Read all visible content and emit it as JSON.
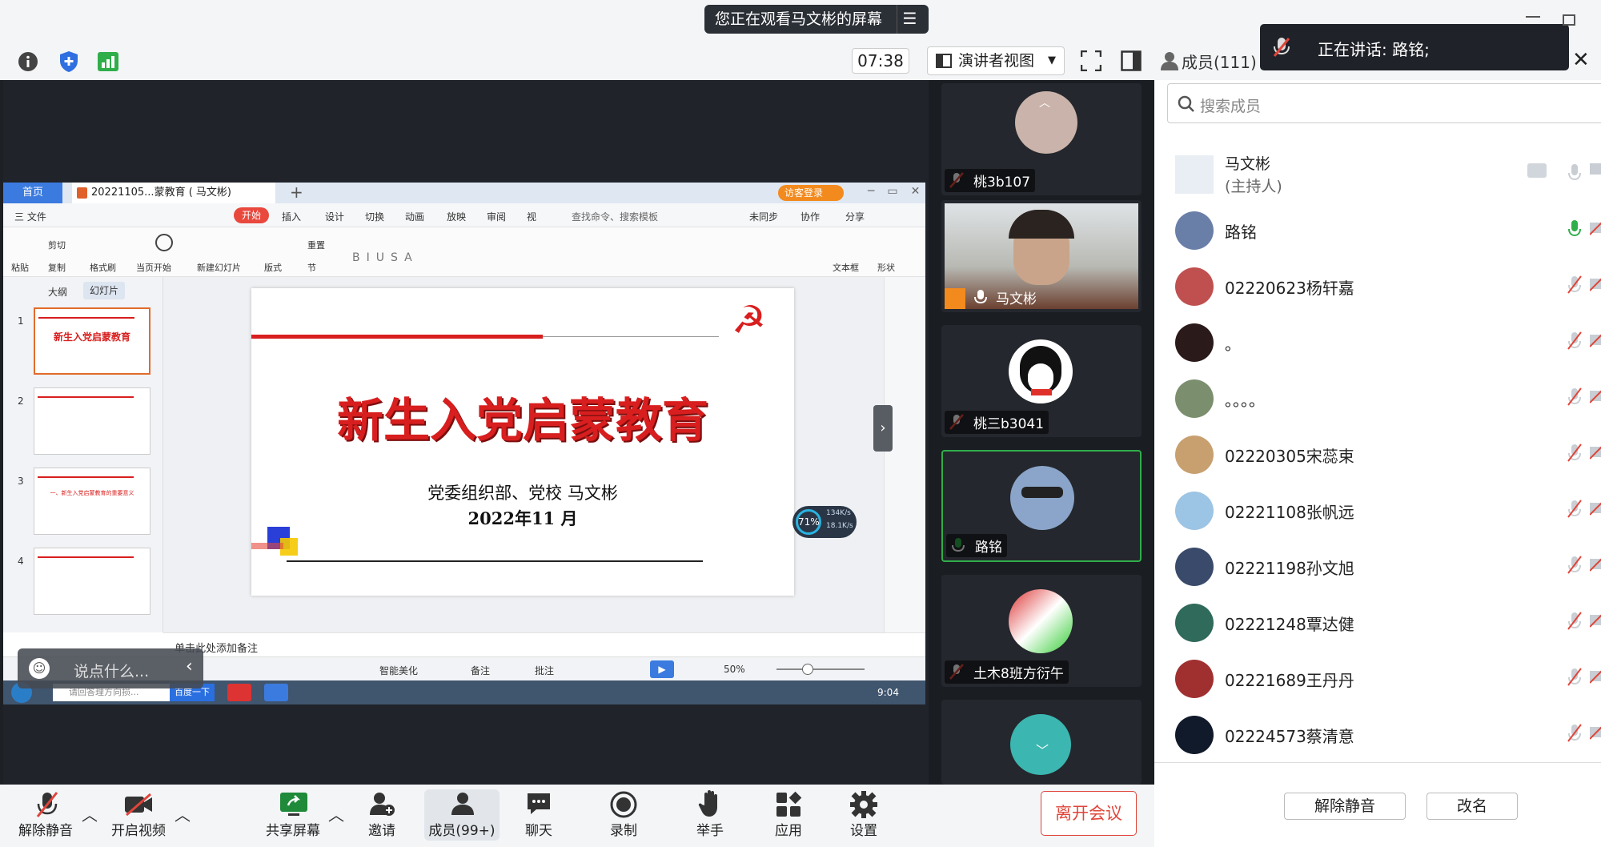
{
  "header": {
    "share_banner": "您正在观看马文彬的屏幕",
    "timer": "07:38",
    "view_mode": "演讲者视图",
    "members_label": "成员(111)",
    "speaking": "正在讲话: 路铭;"
  },
  "search": {
    "placeholder": "搜索成员"
  },
  "host": {
    "name": "马文彬",
    "role": "(主持人)"
  },
  "members": [
    {
      "name": "路铭",
      "color": "#6a7fa8",
      "mic": "on"
    },
    {
      "name": "02220623杨轩嘉",
      "color": "#c05050",
      "mic": "off"
    },
    {
      "name": "。",
      "color": "#2b1a1a",
      "mic": "off"
    },
    {
      "name": "。。。。",
      "color": "#7b8f6f",
      "mic": "off"
    },
    {
      "name": "02220305宋蕊束",
      "color": "#c8a070",
      "mic": "off"
    },
    {
      "name": "02221108张帆远",
      "color": "#9cc4e4",
      "mic": "off"
    },
    {
      "name": "02221198孙文旭",
      "color": "#3a4a6a",
      "mic": "off"
    },
    {
      "name": "02221248覃达健",
      "color": "#2f6a5a",
      "mic": "off"
    },
    {
      "name": "02221689王丹丹",
      "color": "#a03030",
      "mic": "off"
    },
    {
      "name": "02224573蔡清意",
      "color": "#111a2a",
      "mic": "off"
    }
  ],
  "panel_buttons": {
    "unmute_all": "解除静音",
    "rename": "改名"
  },
  "gallery": [
    {
      "name": "桃3b107",
      "mic": "off"
    },
    {
      "name": "马文彬",
      "mic": "on"
    },
    {
      "name": "桃三b3041",
      "mic": "off"
    },
    {
      "name": "路铭",
      "mic": "on"
    },
    {
      "name": "土木8班方衍午",
      "mic": "off"
    }
  ],
  "toolbar": {
    "mute": "解除静音",
    "video": "开启视频",
    "share": "共享屏幕",
    "invite": "邀请",
    "members": "成员(99+)",
    "chat": "聊天",
    "record": "录制",
    "hand": "举手",
    "apps": "应用",
    "settings": "设置",
    "leave": "离开会议"
  },
  "wps": {
    "tab_home": "首页",
    "doc_tab": "20221105...蒙教育 ( 马文彬)",
    "login": "访客登录",
    "menu": [
      "三 文件",
      "开始",
      "插入",
      "设计",
      "切换",
      "动画",
      "放映",
      "审阅",
      "视"
    ],
    "search_cmd": "查找命令、搜索模板",
    "sync": "未同步",
    "collab": "协作",
    "share": "分享",
    "ribbon_labels": [
      "粘贴",
      "剪切",
      "复制",
      "格式刷",
      "当页开始",
      "新建幻灯片",
      "版式",
      "节",
      "重置",
      "文本框",
      "形状"
    ],
    "pane_tabs": [
      "大纲",
      "幻灯片"
    ],
    "notes": "单击此处添加备注",
    "status_beautify": "智能美化",
    "status_notes": "备注",
    "status_comment": "批注",
    "zoom": "50%",
    "say": "说点什么...",
    "search_box": "请回答理方向损...",
    "search_go": "百度一下",
    "clock": "9:04",
    "net_pct": "71%",
    "net_up": "134K/s",
    "net_down": "18.1K/s"
  },
  "slide": {
    "title": "新生入党启蒙教育",
    "author": "党委组织部、党校  马文彬",
    "date": "2022年11 月"
  },
  "thumbs": [
    {
      "num": "1",
      "title": "新生入党启蒙教育"
    },
    {
      "num": "2",
      "title": ""
    },
    {
      "num": "3",
      "title": "一、新生入党启蒙教育的重要意义"
    },
    {
      "num": "4",
      "title": ""
    }
  ],
  "colors": {
    "red": "#d81e1e",
    "blue": "#2f6fe0",
    "green": "#2fae4a",
    "leave": "#e0453a"
  }
}
